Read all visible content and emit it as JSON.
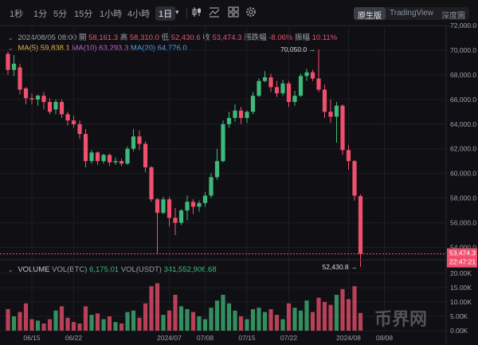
{
  "toolbar": {
    "timeframes": [
      "1秒",
      "1分",
      "5分",
      "15分",
      "1小時",
      "4小時",
      "1日"
    ],
    "active_timeframe": "1日",
    "icons": [
      "chevron-down-icon",
      "candlestick-type-icon",
      "indicators-icon",
      "layout-icon",
      "settings-icon"
    ],
    "view_modes": [
      "原生版",
      "TradingView",
      "深度圖"
    ],
    "active_view_mode": "原生版"
  },
  "ohlc_row": {
    "date": "2024/08/05 08:00",
    "open_label": "開",
    "open": "58,161.3",
    "high_label": "高",
    "high": "58,310.0",
    "low_label": "低",
    "low": "52,430.6",
    "close_label": "收",
    "close": "53,474.3",
    "change_label": "漲跌幅",
    "change": "-8.06%",
    "amplitude_label": "振幅",
    "amplitude": "10.11%"
  },
  "ma_row": {
    "ma5_label": "MA(5)",
    "ma5": "59,838.1",
    "ma10_label": "MA(10)",
    "ma10": "63,293.3",
    "ma20_label": "MA(20)",
    "ma20": "64,776.0"
  },
  "volume_row": {
    "label": "VOLUME",
    "vol_btc_label": "VOL(BTC)",
    "vol_btc": "6,175.01",
    "vol_usdt_label": "VOL(USDT)",
    "vol_usdt": "341,552,906.68"
  },
  "price_axis": {
    "ticks": [
      "72,000.0",
      "70,000.0",
      "68,000.0",
      "66,000.0",
      "64,000.0",
      "62,000.0",
      "60,000.0",
      "58,000.0",
      "56,000.0",
      "54,000.0"
    ],
    "last_price": "53,474.3",
    "countdown": "22:47:21"
  },
  "volume_axis": {
    "ticks": [
      "20.00K",
      "15.00K",
      "10.00K",
      "5.00K",
      "0.00K"
    ]
  },
  "date_axis": {
    "ticks": [
      "06/15",
      "06/22",
      "2024/07",
      "07/08",
      "07/15",
      "07/22",
      "2024/08",
      "08/08"
    ]
  },
  "annotations": {
    "high_marker": "70,050.0",
    "low_marker": "52,430.8"
  },
  "watermark": "币界网",
  "colors": {
    "up": "#3fb97a",
    "down": "#f0506e",
    "background": "#101014",
    "ma5": "#e7b64a",
    "ma10": "#c563d6",
    "ma20": "#4fa3ee"
  },
  "chart_data": {
    "type": "candlestick",
    "price_range": [
      53000,
      72000
    ],
    "volume_range": [
      0,
      20000
    ],
    "grid": true,
    "candles": [
      {
        "o": 69700,
        "h": 69900,
        "l": 68000,
        "c": 68400,
        "v": 7500
      },
      {
        "o": 68400,
        "h": 69600,
        "l": 67900,
        "c": 68900,
        "v": 5000
      },
      {
        "o": 68600,
        "h": 68900,
        "l": 66400,
        "c": 66800,
        "v": 6500
      },
      {
        "o": 66900,
        "h": 67000,
        "l": 65600,
        "c": 66100,
        "v": 9500
      },
      {
        "o": 66100,
        "h": 66500,
        "l": 65600,
        "c": 66000,
        "v": 4000
      },
      {
        "o": 66000,
        "h": 66400,
        "l": 65500,
        "c": 66300,
        "v": 3500
      },
      {
        "o": 66300,
        "h": 66600,
        "l": 65200,
        "c": 65800,
        "v": 2500
      },
      {
        "o": 65800,
        "h": 66100,
        "l": 64800,
        "c": 65000,
        "v": 4000
      },
      {
        "o": 65200,
        "h": 66000,
        "l": 64800,
        "c": 65800,
        "v": 7000
      },
      {
        "o": 65800,
        "h": 66000,
        "l": 64500,
        "c": 64800,
        "v": 8500
      },
      {
        "o": 64800,
        "h": 65000,
        "l": 63900,
        "c": 64300,
        "v": 4500
      },
      {
        "o": 64300,
        "h": 64700,
        "l": 63700,
        "c": 64000,
        "v": 3000
      },
      {
        "o": 64000,
        "h": 64300,
        "l": 62800,
        "c": 63200,
        "v": 2500
      },
      {
        "o": 63200,
        "h": 63600,
        "l": 60500,
        "c": 61000,
        "v": 8500
      },
      {
        "o": 61000,
        "h": 61900,
        "l": 60800,
        "c": 61700,
        "v": 5500
      },
      {
        "o": 61700,
        "h": 61800,
        "l": 60700,
        "c": 61000,
        "v": 6000
      },
      {
        "o": 61000,
        "h": 61600,
        "l": 60800,
        "c": 61500,
        "v": 4000
      },
      {
        "o": 61500,
        "h": 61600,
        "l": 60600,
        "c": 60900,
        "v": 5000
      },
      {
        "o": 60900,
        "h": 61300,
        "l": 60700,
        "c": 61000,
        "v": 3000
      },
      {
        "o": 61000,
        "h": 61200,
        "l": 60600,
        "c": 60800,
        "v": 2500
      },
      {
        "o": 60800,
        "h": 62200,
        "l": 60700,
        "c": 62000,
        "v": 6500
      },
      {
        "o": 62000,
        "h": 63600,
        "l": 61800,
        "c": 63000,
        "v": 7000
      },
      {
        "o": 63000,
        "h": 63500,
        "l": 61900,
        "c": 62400,
        "v": 4500
      },
      {
        "o": 62400,
        "h": 62600,
        "l": 60100,
        "c": 60500,
        "v": 9500
      },
      {
        "o": 60500,
        "h": 60600,
        "l": 57700,
        "c": 57900,
        "v": 15500
      },
      {
        "o": 57900,
        "h": 58000,
        "l": 53500,
        "c": 56800,
        "v": 16500
      },
      {
        "o": 56800,
        "h": 58100,
        "l": 56700,
        "c": 57900,
        "v": 5500
      },
      {
        "o": 57900,
        "h": 58100,
        "l": 55700,
        "c": 56400,
        "v": 7000
      },
      {
        "o": 56400,
        "h": 57200,
        "l": 55000,
        "c": 56000,
        "v": 12500
      },
      {
        "o": 56000,
        "h": 57100,
        "l": 55800,
        "c": 57000,
        "v": 8500
      },
      {
        "o": 57000,
        "h": 58200,
        "l": 56200,
        "c": 57700,
        "v": 7500
      },
      {
        "o": 57700,
        "h": 57900,
        "l": 56700,
        "c": 57300,
        "v": 6500
      },
      {
        "o": 57300,
        "h": 57800,
        "l": 56900,
        "c": 57600,
        "v": 5000
      },
      {
        "o": 57600,
        "h": 58500,
        "l": 57300,
        "c": 58200,
        "v": 4000
      },
      {
        "o": 58200,
        "h": 60000,
        "l": 58000,
        "c": 59700,
        "v": 8000
      },
      {
        "o": 59700,
        "h": 62000,
        "l": 59500,
        "c": 61000,
        "v": 10500
      },
      {
        "o": 61000,
        "h": 64300,
        "l": 60900,
        "c": 64000,
        "v": 12500
      },
      {
        "o": 64000,
        "h": 65000,
        "l": 63700,
        "c": 64500,
        "v": 9500
      },
      {
        "o": 64500,
        "h": 65600,
        "l": 64200,
        "c": 65100,
        "v": 7000
      },
      {
        "o": 65100,
        "h": 65400,
        "l": 64000,
        "c": 64500,
        "v": 5000
      },
      {
        "o": 64500,
        "h": 65100,
        "l": 64100,
        "c": 65000,
        "v": 4000
      },
      {
        "o": 65000,
        "h": 66600,
        "l": 64800,
        "c": 66300,
        "v": 7500
      },
      {
        "o": 66300,
        "h": 67700,
        "l": 66200,
        "c": 67500,
        "v": 8000
      },
      {
        "o": 67500,
        "h": 68300,
        "l": 67400,
        "c": 67800,
        "v": 6500
      },
      {
        "o": 67800,
        "h": 68100,
        "l": 66600,
        "c": 67000,
        "v": 7500
      },
      {
        "o": 67000,
        "h": 67500,
        "l": 66200,
        "c": 66500,
        "v": 5500
      },
      {
        "o": 66500,
        "h": 67600,
        "l": 66300,
        "c": 67300,
        "v": 4000
      },
      {
        "o": 67300,
        "h": 67500,
        "l": 65400,
        "c": 65800,
        "v": 9500
      },
      {
        "o": 65800,
        "h": 66700,
        "l": 65500,
        "c": 66300,
        "v": 8000
      },
      {
        "o": 66300,
        "h": 68100,
        "l": 66200,
        "c": 67900,
        "v": 7000
      },
      {
        "o": 67900,
        "h": 68500,
        "l": 67500,
        "c": 68200,
        "v": 10500
      },
      {
        "o": 68200,
        "h": 68400,
        "l": 67500,
        "c": 67700,
        "v": 6500
      },
      {
        "o": 67700,
        "h": 70050,
        "l": 66600,
        "c": 66800,
        "v": 11500
      },
      {
        "o": 66800,
        "h": 67200,
        "l": 64500,
        "c": 65000,
        "v": 10000
      },
      {
        "o": 65000,
        "h": 66000,
        "l": 64100,
        "c": 64600,
        "v": 9000
      },
      {
        "o": 64600,
        "h": 65800,
        "l": 62500,
        "c": 65500,
        "v": 12500
      },
      {
        "o": 65500,
        "h": 65600,
        "l": 61500,
        "c": 61900,
        "v": 14500
      },
      {
        "o": 61900,
        "h": 62300,
        "l": 60300,
        "c": 61000,
        "v": 11000
      },
      {
        "o": 61000,
        "h": 61100,
        "l": 57800,
        "c": 58200,
        "v": 15500
      },
      {
        "o": 58161.3,
        "h": 58310,
        "l": 52430.6,
        "c": 53474.3,
        "v": 6175
      }
    ]
  }
}
